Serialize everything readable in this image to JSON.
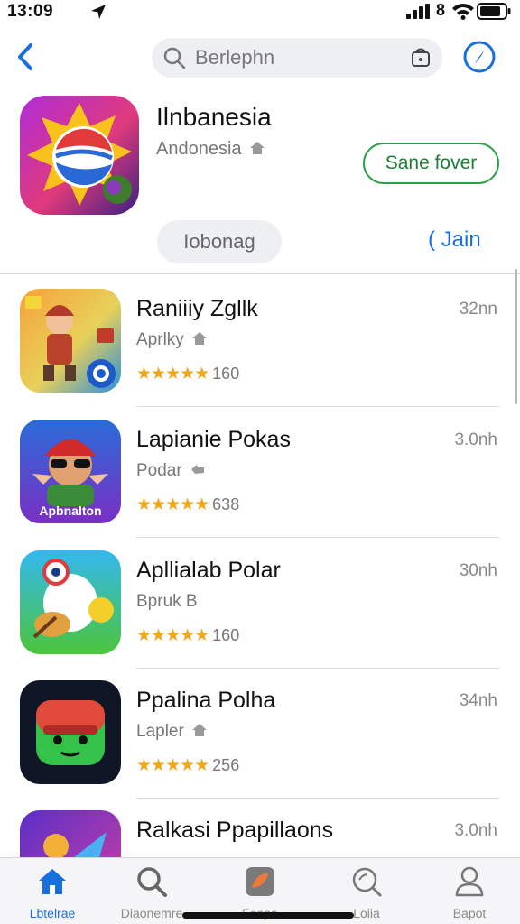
{
  "status": {
    "time": "13:09",
    "bt": "8"
  },
  "header": {
    "search_placeholder": "Berlephn"
  },
  "featured": {
    "title": "Ilnbanesia",
    "subtitle": "Andonesia",
    "get_label": "Sane fover",
    "chip_label": "Iobonag",
    "see_label": "( Jain"
  },
  "apps": [
    {
      "name": "Raniiiy Zgllk",
      "category": "Aprlky",
      "stars": "★★★★★",
      "rating": "160",
      "size": "32nn"
    },
    {
      "name": "Lapianie Pokas",
      "category": "Podar",
      "stars": "★★★★★",
      "rating": "638",
      "size": "3.0nh",
      "icon_text": "Apbnalton"
    },
    {
      "name": "Apllialab Polar",
      "category": "Bpruk B",
      "stars": "★★★★★",
      "rating": "160",
      "size": "30nh"
    },
    {
      "name": "Ppalina Polha",
      "category": "Lapler",
      "stars": "★★★★★",
      "rating": "256",
      "size": "34nh"
    },
    {
      "name": "Ralkasi Ppapillaons",
      "category": "",
      "stars": "",
      "rating": "",
      "size": "3.0nh"
    }
  ],
  "tabs": [
    {
      "label": "Lbtelrae",
      "icon": "home-icon",
      "active": true
    },
    {
      "label": "Diaonemre",
      "icon": "search-icon",
      "active": false
    },
    {
      "label": "Feapa",
      "icon": "arcade-icon",
      "active": false
    },
    {
      "label": "Loiia",
      "icon": "magnifier-icon",
      "active": false
    },
    {
      "label": "Bapot",
      "icon": "person-icon",
      "active": false
    }
  ],
  "colors": {
    "accent": "#1a6fdf",
    "get_green": "#2e9e48",
    "star": "#f2a71b"
  }
}
